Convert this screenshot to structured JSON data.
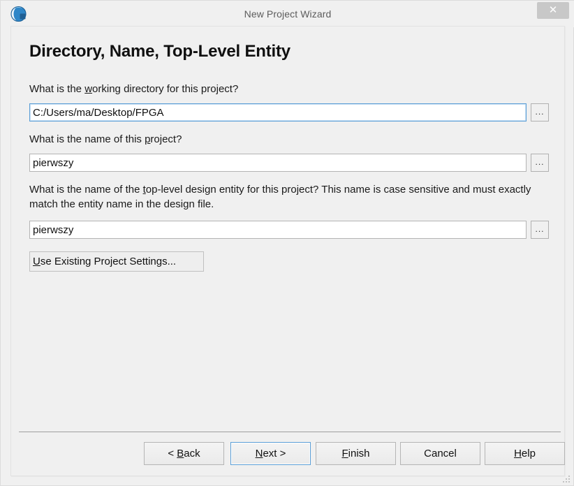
{
  "window": {
    "title": "New Project Wizard",
    "icon": "quartus-globe-icon",
    "close_label": "✕"
  },
  "page": {
    "heading": "Directory, Name, Top-Level Entity"
  },
  "fields": [
    {
      "label_prefix": "What is the ",
      "label_mnemonic": "w",
      "label_suffix": "orking directory for this project?",
      "label_full": "What is the working directory for this project?",
      "value": "C:/Users/ma/Desktop/FPGA",
      "placeholder": "",
      "browse_label": "...",
      "focused": true
    },
    {
      "label_prefix": "What is the name of this ",
      "label_mnemonic": "p",
      "label_suffix": "roject?",
      "label_full": "What is the name of this project?",
      "value": "pierwszy",
      "placeholder": "",
      "browse_label": "...",
      "focused": false
    },
    {
      "label_prefix": "What is the name of the ",
      "label_mnemonic": "t",
      "label_suffix": "op-level design entity for this project? This name is case sensitive and must exactly match the entity name in the design file.",
      "label_full": "What is the name of the top-level design entity for this project? This name is case sensitive and must exactly match the entity name in the design file.",
      "value": "pierwszy",
      "placeholder": "",
      "browse_label": "...",
      "focused": false
    }
  ],
  "use_existing": {
    "prefix": "",
    "mnemonic": "U",
    "suffix": "se Existing Project Settings..."
  },
  "footer": {
    "buttons": [
      {
        "prefix": "< ",
        "mnemonic": "B",
        "suffix": "ack",
        "full": "< Back",
        "default": false
      },
      {
        "prefix": "",
        "mnemonic": "N",
        "suffix": "ext >",
        "full": "Next >",
        "default": true
      },
      {
        "prefix": "",
        "mnemonic": "F",
        "suffix": "inish",
        "full": "Finish",
        "default": false
      },
      {
        "prefix": "",
        "mnemonic": "",
        "suffix": "Cancel",
        "full": "Cancel",
        "default": false
      },
      {
        "prefix": "",
        "mnemonic": "H",
        "suffix": "elp",
        "full": "Help",
        "default": false
      }
    ]
  },
  "colors": {
    "background": "#f0f0f0",
    "accent": "#5a9ed6",
    "text": "#1a1a1a",
    "title_text": "#5c5c5c",
    "close_bg": "#c8c8c8"
  }
}
